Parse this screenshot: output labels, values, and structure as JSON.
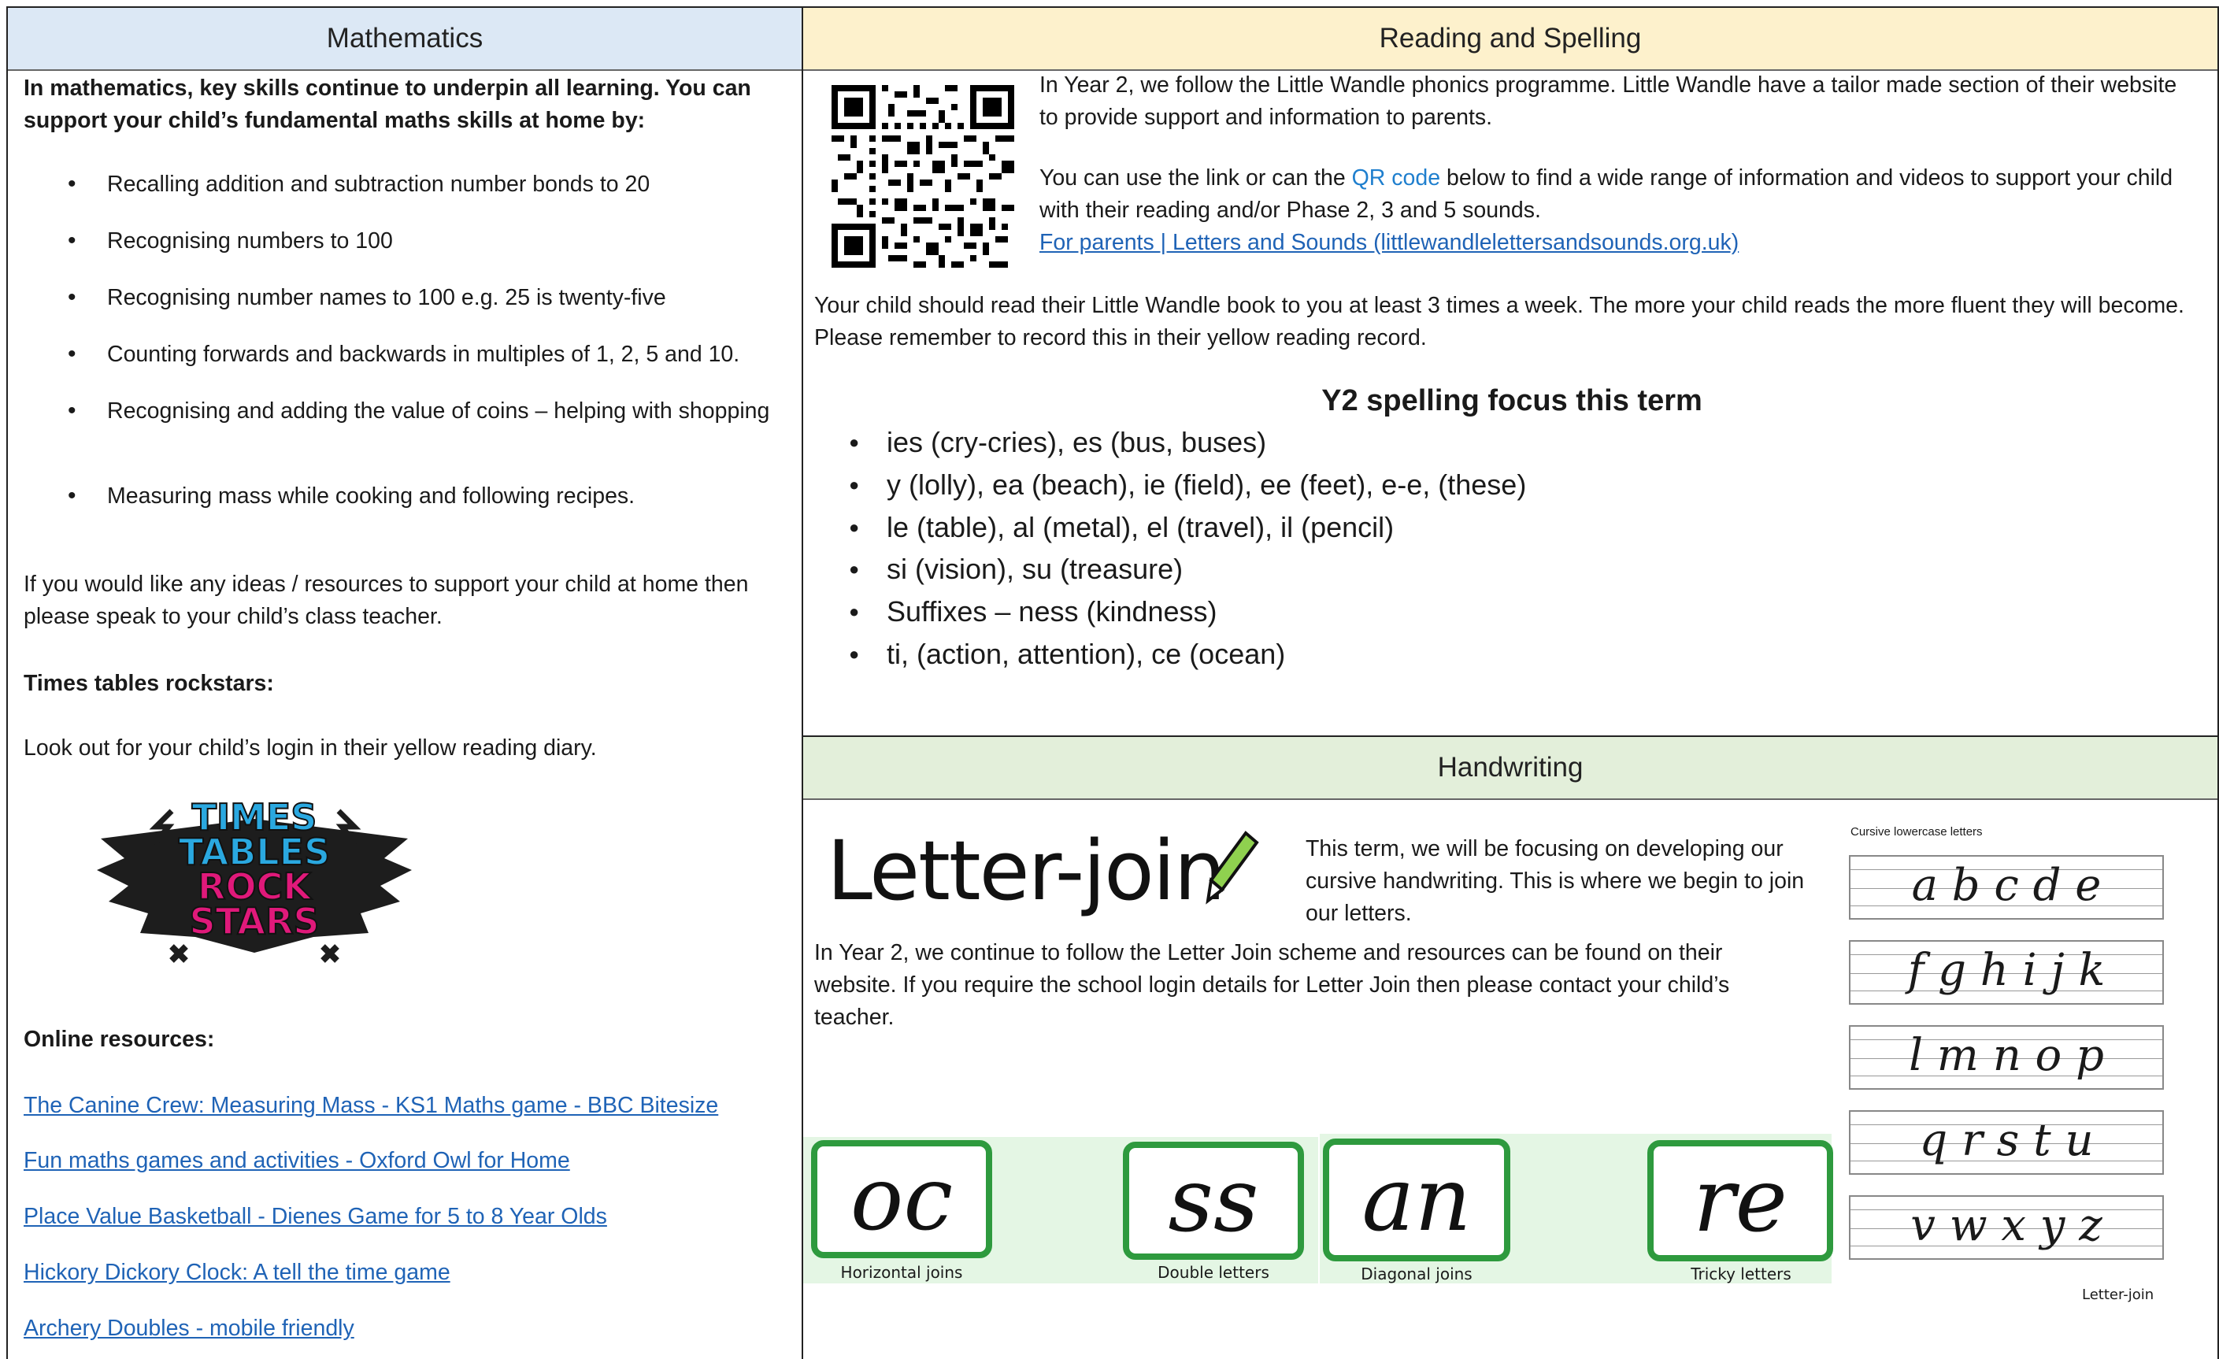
{
  "maths": {
    "header": "Mathematics",
    "intro": "In mathematics, key skills continue to underpin all learning. You can support your child’s fundamental maths skills at home by:",
    "skills": [
      "Recalling addition and subtraction number bonds to 20",
      "Recognising numbers to 100",
      "Recognising number names to 100 e.g. 25 is twenty-five",
      "Counting forwards and backwards in multiples of 1, 2, 5 and 10.",
      "Recognising and adding the value of coins – helping with shopping",
      "Measuring mass while cooking and following recipes."
    ],
    "ideas": "If you would like any ideas / resources to support your child at home then please speak to your child’s class teacher.",
    "ttrs_heading": "Times tables rockstars:",
    "ttrs_text": "Look out for your child’s login in their yellow reading diary.",
    "ttrs_logo": [
      "TIMES",
      "TABLES",
      "ROCK",
      "STARS"
    ],
    "online_heading": "Online resources:",
    "links": [
      "The Canine Crew: Measuring Mass - KS1 Maths game - BBC Bitesize",
      "Fun maths games and activities - Oxford Owl for Home",
      "Place Value Basketball - Dienes Game for 5 to 8 Year Olds",
      "Hickory Dickory Clock: A tell the time game",
      "Archery Doubles - mobile friendly"
    ]
  },
  "reading": {
    "header": "Reading and Spelling",
    "para1": "In Year 2, we follow the Little Wandle phonics programme. Little Wandle have a tailor made section of their website to provide support and information to parents.",
    "para2_pre": "You can use the link or can the ",
    "para2_link": "QR code",
    "para2_post": " below to find a wide range of information and videos to support your child with their reading and/or Phase 2, 3 and 5 sounds.",
    "parents_link": "For parents | Letters and Sounds (littlewandlelettersandsounds.org.uk)",
    "para3": "Your child should read their Little Wandle book to you at least 3 times a week. The more your child reads the more fluent they will become. Please remember to record this in their yellow reading record.",
    "spelling_title": "Y2 spelling focus this term",
    "spelling": [
      "ies (cry-cries), es (bus, buses)",
      "y (lolly), ea (beach), ie (field), ee (feet), e-e, (these)",
      "le (table), al (metal), el (travel), il (pencil)",
      "si (vision), su (treasure)",
      "Suffixes – ness (kindness)",
      "ti, (action, attention), ce (ocean)"
    ]
  },
  "handwriting": {
    "header": "Handwriting",
    "logo_text": "Letter-join",
    "intro": "This term, we will be focusing on developing our cursive handwriting. This is where we begin to join our letters.",
    "scheme": "In Year 2, we continue to follow the Letter Join scheme and resources can be found on their website. If you require the school login details for Letter Join then please contact your child’s teacher.",
    "joins": [
      {
        "glyph": "oc",
        "caption": "Horizontal joins"
      },
      {
        "glyph": "ss",
        "caption": "Double letters"
      },
      {
        "glyph": "an",
        "caption": "Diagonal joins"
      },
      {
        "glyph": "re",
        "caption": "Tricky letters"
      }
    ],
    "cursive_title": "Cursive lowercase letters",
    "cursive_rows": [
      "a b c d e",
      "f g h i j k",
      "l m n o p",
      "q r s t u",
      "v w x y z"
    ],
    "small_logo": "Letter-join",
    "accent": "#2e9a3e"
  }
}
